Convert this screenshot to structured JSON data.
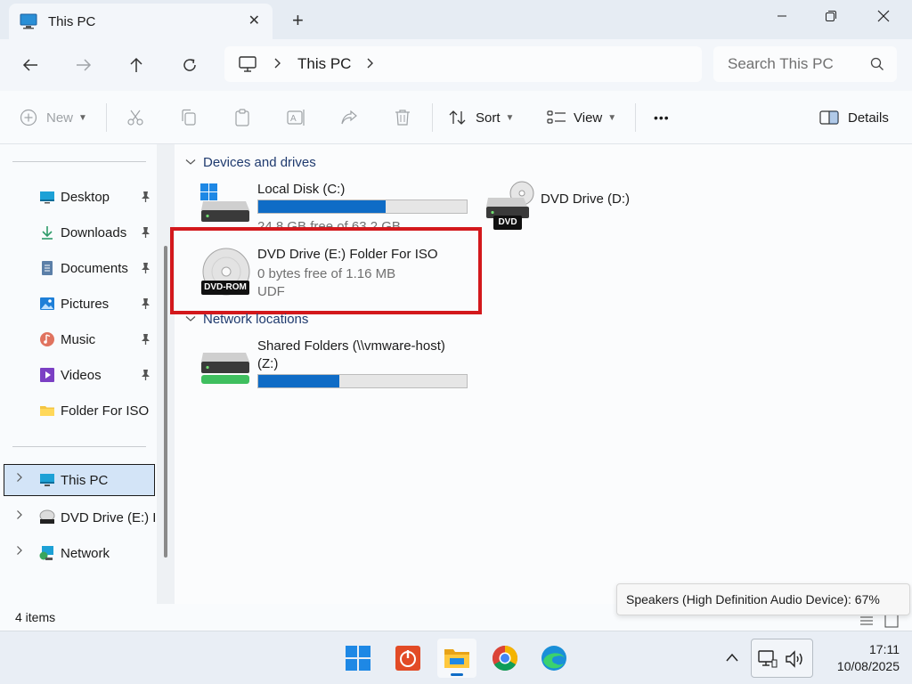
{
  "window": {
    "tab_title": "This PC",
    "close_tab": "✕",
    "new_tab": "+"
  },
  "address": {
    "crumb": "This PC",
    "search_placeholder": "Search This PC"
  },
  "toolbar": {
    "new_label": "New",
    "sort_label": "Sort",
    "view_label": "View",
    "more_label": "•••",
    "details_label": "Details"
  },
  "sidebar": {
    "quick_access": [
      {
        "label": "Desktop",
        "icon": "desktop-icon"
      },
      {
        "label": "Downloads",
        "icon": "downloads-icon"
      },
      {
        "label": "Documents",
        "icon": "documents-icon"
      },
      {
        "label": "Pictures",
        "icon": "pictures-icon"
      },
      {
        "label": "Music",
        "icon": "music-icon"
      },
      {
        "label": "Videos",
        "icon": "videos-icon"
      },
      {
        "label": "Folder For ISO",
        "icon": "folder-icon"
      }
    ],
    "tree": [
      {
        "label": "This PC",
        "icon": "pc-icon",
        "selected": true
      },
      {
        "label": "DVD Drive (E:) F",
        "icon": "dvd-rom-icon"
      },
      {
        "label": "Network",
        "icon": "network-icon"
      }
    ]
  },
  "content": {
    "groups": {
      "devices": "Devices and drives",
      "network": "Network locations"
    },
    "drives": {
      "c": {
        "name": "Local Disk (C:)",
        "free_text": "24.8 GB free of 63.2 GB",
        "used_fraction": 0.61
      },
      "d": {
        "name": "DVD Drive (D:)",
        "badge": "DVD"
      },
      "e": {
        "name": "DVD Drive (E:) Folder For ISO",
        "free_text": "0 bytes free of 1.16 MB",
        "filesystem": "UDF",
        "badge": "DVD-ROM"
      },
      "z": {
        "name_line1": "Shared Folders (\\\\vmware-host)",
        "name_line2": "(Z:)",
        "used_fraction": 0.39
      }
    }
  },
  "status": {
    "item_count": "4 items",
    "tooltip": "Speakers (High Definition Audio Device): 67%"
  },
  "taskbar": {
    "time": "17:11",
    "date": "10/08/2025"
  },
  "colors": {
    "accent": "#0f6cc6",
    "highlight": "#d3181c",
    "group_heading": "#1f3a6e"
  }
}
